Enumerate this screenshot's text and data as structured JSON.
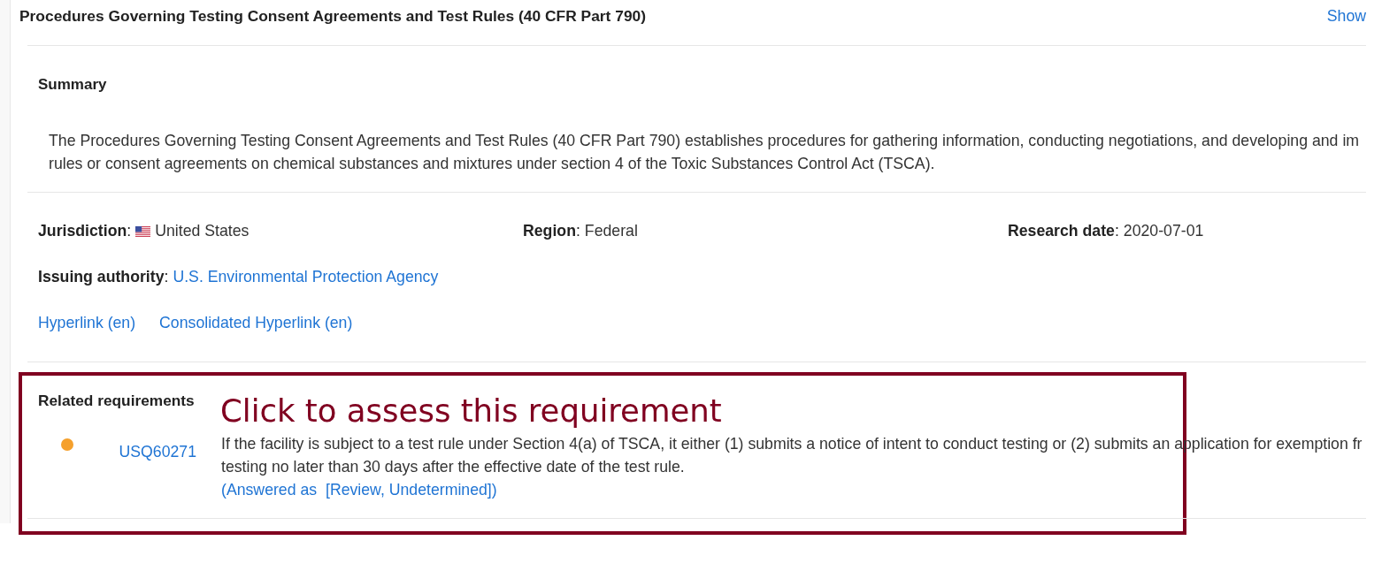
{
  "header": {
    "title": "Procedures Governing Testing Consent Agreements and Test Rules (40 CFR Part 790)",
    "action": "Show"
  },
  "summary": {
    "heading": "Summary",
    "lines": [
      "The Procedures Governing Testing Consent Agreements and Test Rules (40 CFR Part 790) establishes procedures for gathering information, conducting negotiations, and developing and im",
      "rules or consent agreements on chemical substances and mixtures under section 4 of the Toxic Substances Control Act (TSCA)."
    ]
  },
  "details": [
    {
      "kind": "flag",
      "label": "**Jurisdiction**:",
      "value": "United States"
    },
    {
      "kind": "text",
      "label": "**Region**:",
      "value": "Federal"
    },
    {
      "kind": "text",
      "label": "**Research date**:",
      "value": "2020-07-01"
    },
    {
      "kind": "link",
      "label": "**Issuing authority**:",
      "value": "U.S. Environmental Protection Agency"
    }
  ],
  "links": [
    "Hyperlink (en)",
    "Consolidated Hyperlink (en)"
  ],
  "related_requirements": {
    "heading": "Related requirements",
    "items": [
      {
        "id": "USQ60271",
        "color": "#f5a02c",
        "lines": [
          "If the facility is subject to a test rule under Section 4(a) of TSCA, it either (1) submits a notice of intent to conduct testing or (2) submits an application for exemption fr",
          "testing no later than 30 days after the effective date of the test rule."
        ],
        "answer": "(Answered as  [Review, Undetermined])"
      }
    ]
  },
  "annotation": {
    "text": "Click to assess this requirement"
  }
}
